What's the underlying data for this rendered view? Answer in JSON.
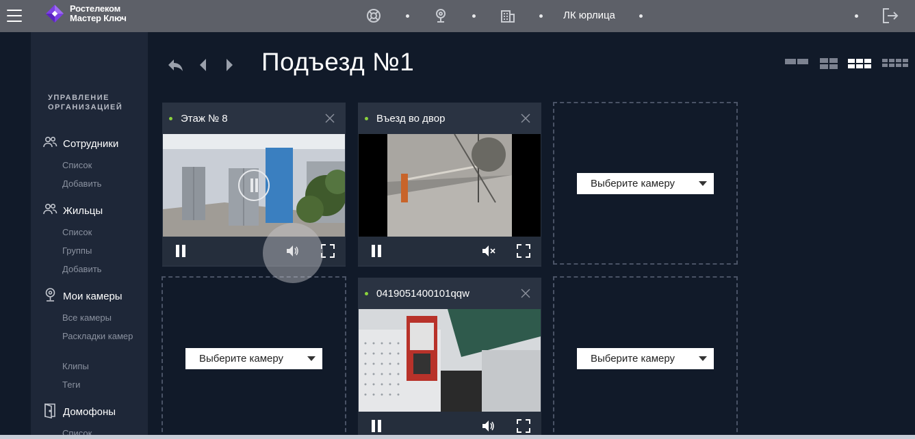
{
  "brand": {
    "line1": "Ростелеком",
    "line2": "Мастер Ключ"
  },
  "topbar": {
    "icons": [
      "lifebuoy-icon",
      "camera-icon",
      "building-icon"
    ],
    "account_label": "ЛК юрлица",
    "logout_icon": "logout-icon"
  },
  "sidebar": {
    "title": "УПРАВЛЕНИЕ ОРГАНИЗАЦИЕЙ",
    "sections": [
      {
        "label": "Сотрудники",
        "icon": "people-icon",
        "items": [
          "Список",
          "Добавить"
        ]
      },
      {
        "label": "Жильцы",
        "icon": "people-icon",
        "items": [
          "Список",
          "Группы",
          "Добавить"
        ]
      },
      {
        "label": "Мои камеры",
        "icon": "webcam-icon",
        "items": [
          "Все камеры",
          "Раскладки камер",
          "Клипы",
          "Теги"
        ]
      },
      {
        "label": "Домофоны",
        "icon": "door-icon",
        "items": [
          "Список"
        ]
      }
    ]
  },
  "page": {
    "title": "Подъезд №1"
  },
  "layouts": [
    "1x2",
    "2x2",
    "3x3",
    "4x4"
  ],
  "active_layout": "3x3",
  "cameras": [
    {
      "name": "Этаж № 8",
      "status": "online",
      "muted": false
    },
    {
      "name": "Въезд во двор",
      "status": "online",
      "muted": true
    },
    {
      "name": "0419051400101qqw",
      "status": "online",
      "muted": false
    }
  ],
  "empty_slot": {
    "select_label": "Выберите камеру"
  },
  "colors": {
    "topbar": "#5d6068",
    "background": "#111a29",
    "sidebar": "#1e2738",
    "online": "#8bd33c",
    "brand": "#7b3fe4"
  }
}
